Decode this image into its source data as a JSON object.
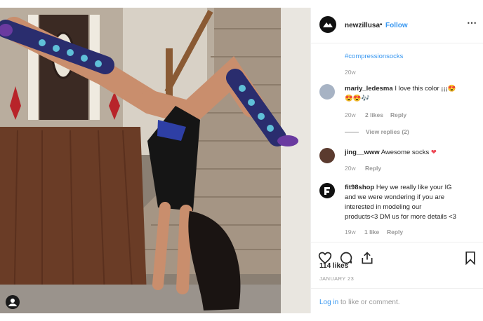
{
  "post": {
    "username": "newzillusa",
    "separator": "•",
    "follow_label": "Follow",
    "more_icon": "⋯"
  },
  "comments": {
    "caption_tag": "#compressionsocks",
    "caption_time": "20w",
    "items": [
      {
        "user": "mariy_ledesma",
        "text": "I love this color ¡¡¡😍",
        "text2": "😍😍🎶",
        "time": "20w",
        "likes": "2 likes",
        "reply": "Reply",
        "view_replies": "View replies (2)"
      },
      {
        "user": "jing__www",
        "text": "Awesome socks",
        "heart": "❤",
        "time": "20w",
        "reply": "Reply"
      },
      {
        "user": "fit98shop",
        "text_lines": [
          "Hey we really like your IG",
          "and we were wondering if you are",
          "interested in modeling our",
          "products<3 DM us for more details <3"
        ],
        "time": "19w",
        "likes": "1 like",
        "reply": "Reply"
      }
    ]
  },
  "actions": {
    "likes": "114 likes",
    "date": "JANUARY 23"
  },
  "login": {
    "link": "Log in",
    "rest": "to like or comment."
  },
  "colors": {
    "link": "#3897f0",
    "muted": "#999999",
    "text": "#262626",
    "heart": "#ed4956"
  }
}
